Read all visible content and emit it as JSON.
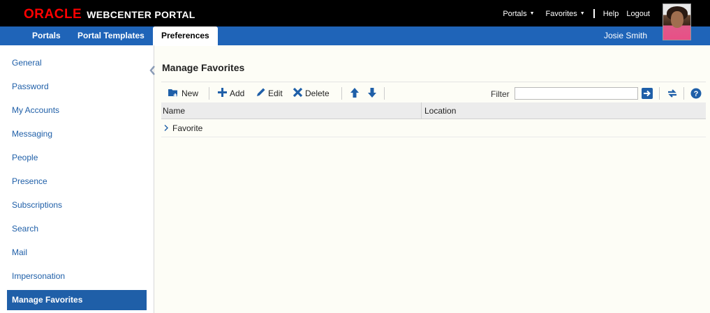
{
  "brand": {
    "logo_oracle": "ORACLE",
    "logo_product": "WEBCENTER PORTAL"
  },
  "top_links": {
    "portals": "Portals",
    "favorites": "Favorites",
    "help": "Help",
    "logout": "Logout"
  },
  "user": {
    "name": "Josie Smith",
    "avatar": "user-avatar-photo"
  },
  "nav_tabs": [
    {
      "label": "Portals"
    },
    {
      "label": "Portal Templates"
    },
    {
      "label": "Preferences",
      "active": true
    }
  ],
  "sidebar": {
    "items": [
      {
        "label": "General"
      },
      {
        "label": "Password"
      },
      {
        "label": "My Accounts"
      },
      {
        "label": "Messaging"
      },
      {
        "label": "People"
      },
      {
        "label": "Presence"
      },
      {
        "label": "Subscriptions"
      },
      {
        "label": "Search"
      },
      {
        "label": "Mail"
      },
      {
        "label": "Impersonation"
      },
      {
        "label": "Manage Favorites",
        "active": true
      }
    ]
  },
  "main": {
    "title": "Manage Favorites",
    "toolbar": {
      "new_label": "New",
      "add_label": "Add",
      "edit_label": "Edit",
      "delete_label": "Delete",
      "filter_label": "Filter",
      "filter_value": "",
      "icons": [
        "new-folder-icon",
        "add-icon",
        "edit-pencil-icon",
        "delete-x-icon",
        "move-up-icon",
        "move-down-icon",
        "go-arrow-icon",
        "refresh-icon",
        "help-icon"
      ]
    },
    "table": {
      "columns": [
        "Name",
        "Location"
      ],
      "rows": [
        {
          "name": "Favorite",
          "location": ""
        }
      ]
    }
  },
  "colors": {
    "top_bar": "#000000",
    "nav_bar": "#1f64b8",
    "oracle_red": "#ff0000",
    "link_blue": "#1f5fa8",
    "page_bg": "#fdfdf6"
  }
}
